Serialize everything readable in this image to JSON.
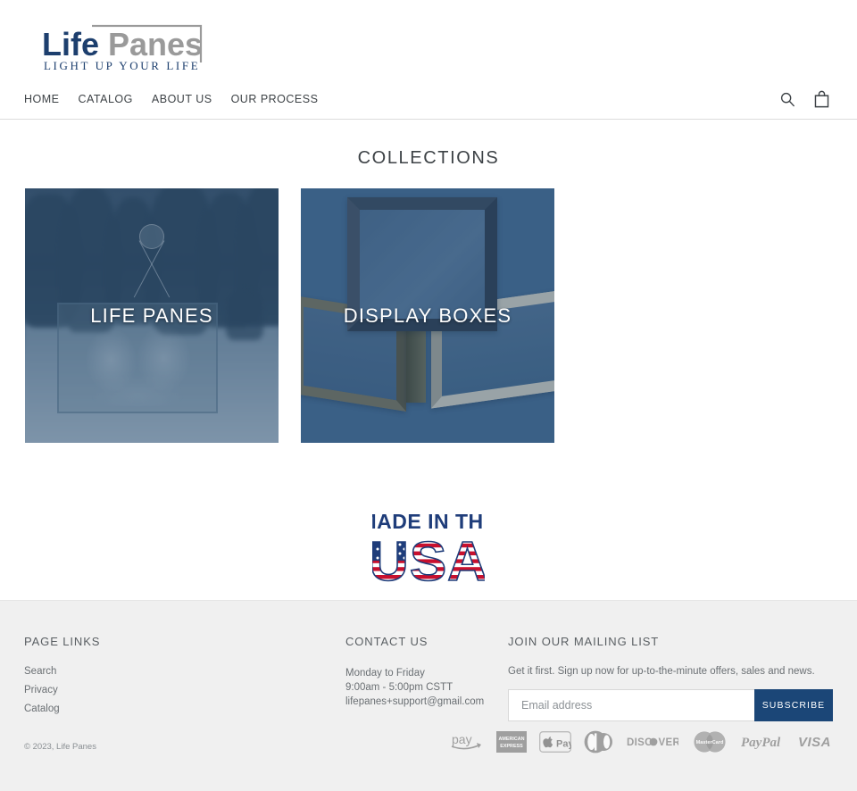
{
  "brand": {
    "name_part1": "Life",
    "name_part2": "Panes",
    "tagline": "LIGHT UP YOUR LIFE",
    "color_primary": "#1d3f6e",
    "color_secondary": "#9a9a9a"
  },
  "nav": {
    "items": [
      {
        "label": "HOME",
        "name": "nav-link-home"
      },
      {
        "label": "CATALOG",
        "name": "nav-link-catalog"
      },
      {
        "label": "ABOUT US",
        "name": "nav-link-about-us"
      },
      {
        "label": "OUR PROCESS",
        "name": "nav-link-our-process"
      }
    ],
    "icons": [
      {
        "label": "search-icon"
      },
      {
        "label": "cart-icon"
      }
    ]
  },
  "main": {
    "title": "COLLECTIONS",
    "collections": [
      {
        "label": "LIFE PANES",
        "name": "collection-card-life-panes"
      },
      {
        "label": "DISPLAY BOXES",
        "name": "collection-card-display-boxes"
      }
    ],
    "badge": {
      "line1": "MADE IN THE",
      "line2": "USA",
      "color_text": "#1f3d7a",
      "color_stripe": "#c8102e"
    }
  },
  "footer": {
    "page_links": {
      "heading": "PAGE LINKS",
      "items": [
        {
          "label": "Search"
        },
        {
          "label": "Privacy"
        },
        {
          "label": "Catalog"
        }
      ]
    },
    "contact": {
      "heading": "CONTACT US",
      "line1": "Monday to Friday",
      "line2": "9:00am - 5:00pm CSTT",
      "line3": "lifepanes+support@gmail.com"
    },
    "mailing": {
      "heading": "JOIN OUR MAILING LIST",
      "description": "Get it first. Sign up now for up-to-the-minute offers, sales and news.",
      "placeholder": "Email address",
      "value": "",
      "button": "SUBSCRIBE",
      "button_color": "#1b4677"
    },
    "copyright": "© 2023, Life Panes",
    "payments": [
      {
        "label": "pay",
        "name": "amazon-pay-icon"
      },
      {
        "label": "AMERICAN EXPRESS",
        "name": "american-express-icon"
      },
      {
        "label": "Pay",
        "name": "apple-pay-icon"
      },
      {
        "label": "Diners Club",
        "name": "diners-club-icon"
      },
      {
        "label": "DISCOVER",
        "name": "discover-icon"
      },
      {
        "label": "MasterCard",
        "name": "mastercard-icon"
      },
      {
        "label": "PayPal",
        "name": "paypal-icon"
      },
      {
        "label": "VISA",
        "name": "visa-icon"
      }
    ]
  }
}
